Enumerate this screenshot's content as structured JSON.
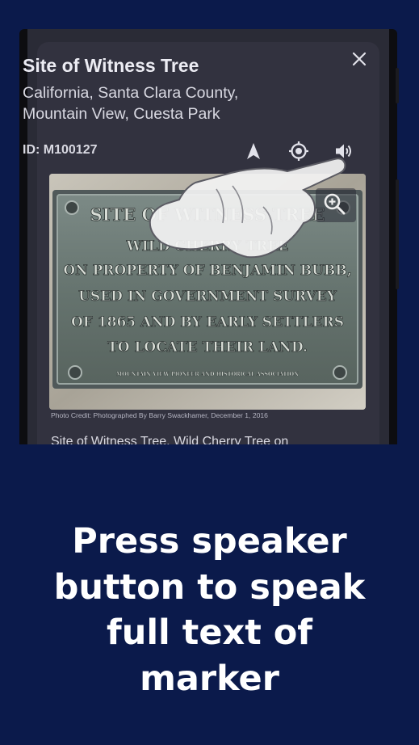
{
  "marker": {
    "title": "Site of Witness Tree",
    "address": "California, Santa Clara County, Mountain View, Cuesta Park",
    "id_label": "ID: M100127",
    "photo_credit": "Photo Credit: Photographed By Barry Swackhamer, December 1, 2016",
    "description_preview": "Site of Witness Tree. Wild Cherry Tree on"
  },
  "plaque": {
    "lines": [
      "SITE OF WITNESS TREE",
      "WILD CHERRY TREE",
      "ON PROPERTY OF BENJAMIN BUBB,",
      "USED IN GOVERNMENT SURVEY",
      "OF 1865 AND BY EARLY SETTLERS",
      "TO LOCATE THEIR LAND.",
      "MOUNTAIN VIEW PIONEER AND HISTORICAL ASSOCIATION"
    ]
  },
  "icons": {
    "close": "close-icon",
    "navigate": "navigation-arrow-icon",
    "locate": "gps-target-icon",
    "speaker": "speaker-icon",
    "zoom": "zoom-in-icon",
    "hand": "pointing-hand-icon"
  },
  "promo": {
    "lines": [
      "Press speaker",
      "button to speak",
      "full text of",
      "marker"
    ]
  },
  "colors": {
    "background": "#0b1a4b",
    "sheet": "#32323f",
    "text_primary": "#ececf3"
  }
}
